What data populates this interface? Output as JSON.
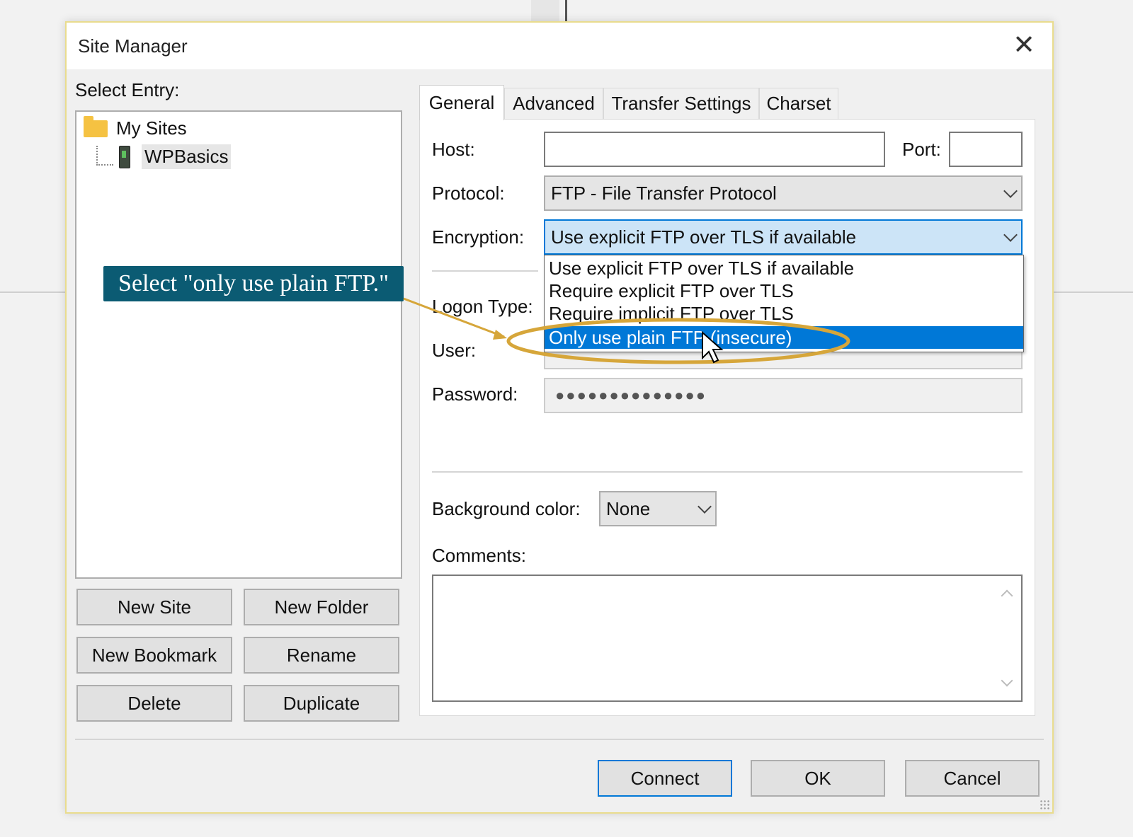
{
  "dialog": {
    "title": "Site Manager",
    "close_label": "✕"
  },
  "left_panel": {
    "select_entry_label": "Select Entry:",
    "tree": {
      "root_label": "My Sites",
      "child_label": "WPBasics"
    },
    "buttons": {
      "new_site": "New Site",
      "new_folder": "New Folder",
      "new_bookmark": "New Bookmark",
      "rename": "Rename",
      "delete": "Delete",
      "duplicate": "Duplicate"
    }
  },
  "tabs": [
    "General",
    "Advanced",
    "Transfer Settings",
    "Charset"
  ],
  "general": {
    "host_label": "Host:",
    "port_label": "Port:",
    "protocol_label": "Protocol:",
    "protocol_value": "FTP - File Transfer Protocol",
    "encryption_label": "Encryption:",
    "encryption_value": "Use explicit FTP over TLS if available",
    "encryption_options": [
      "Use explicit FTP over TLS if available",
      "Require explicit FTP over TLS",
      "Require implicit FTP over TLS",
      "Only use plain FTP (insecure)"
    ],
    "logon_type_label": "Logon Type:",
    "user_label": "User:",
    "password_label": "Password:",
    "password_mask": "●●●●●●●●●●●●●●",
    "background_color_label": "Background color:",
    "background_color_value": "None",
    "comments_label": "Comments:"
  },
  "footer_buttons": {
    "connect": "Connect",
    "ok": "OK",
    "cancel": "Cancel"
  },
  "annotation": {
    "callout_text": "Select \"only use plain FTP.\""
  },
  "colors": {
    "callout_bg": "#0b5b73",
    "highlight_ellipse": "#d6a63a",
    "selection_blue": "#0078d7"
  }
}
